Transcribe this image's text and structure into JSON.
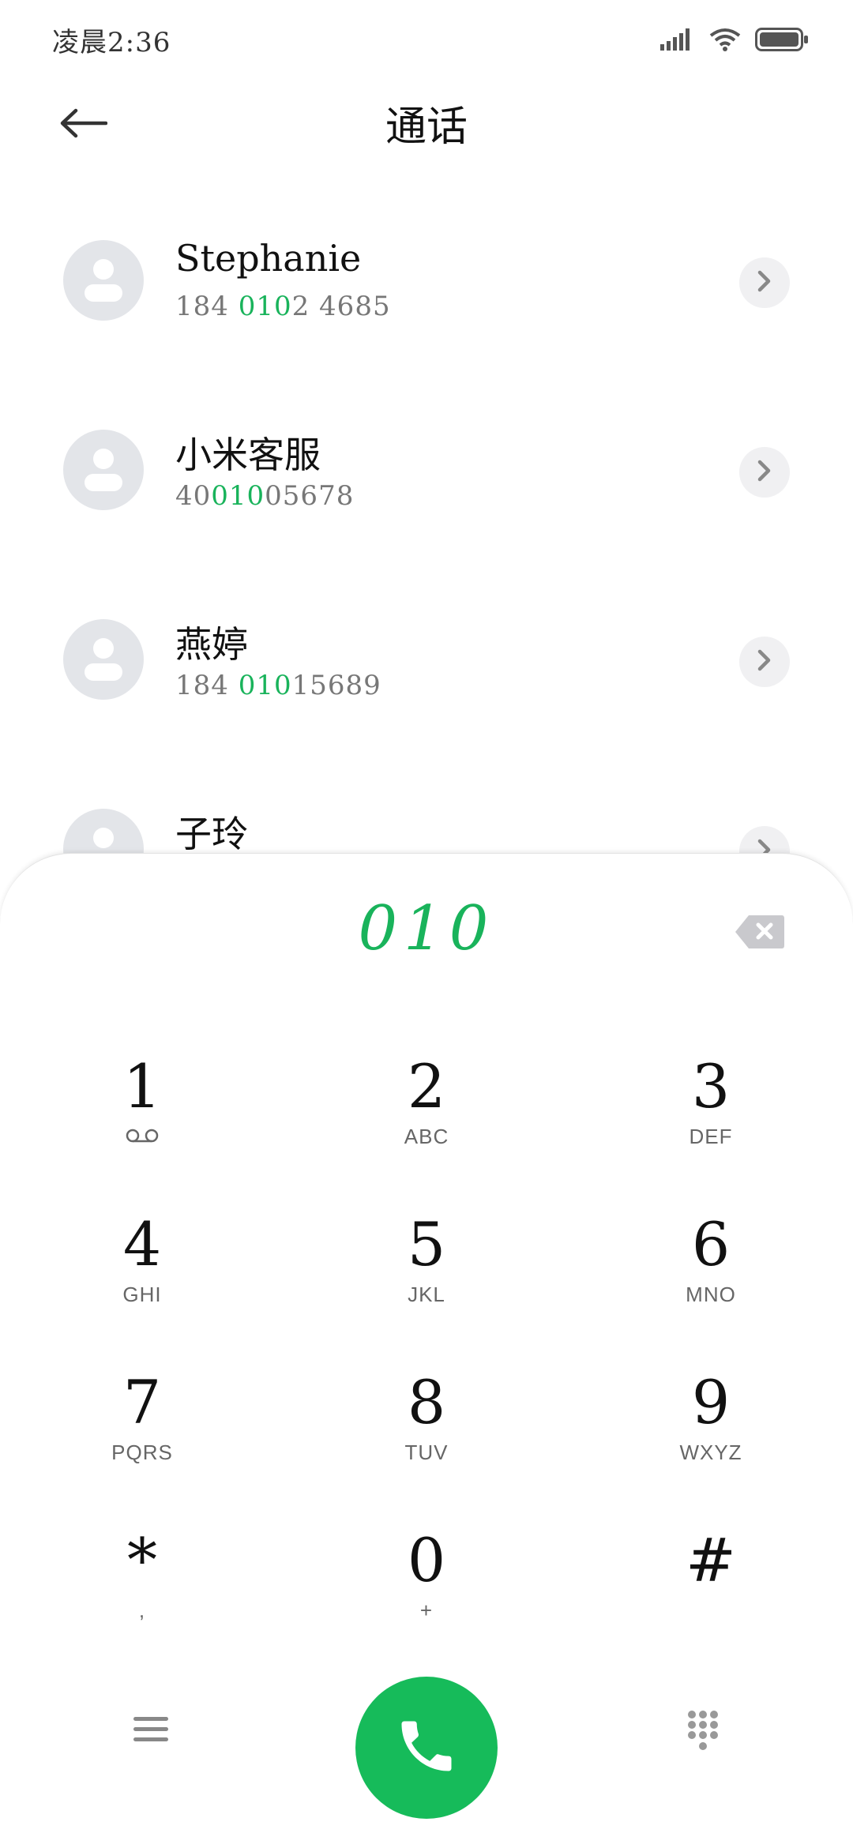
{
  "status_bar": {
    "time": "凌晨2:36",
    "icons": [
      "signal-icon",
      "wifi-icon",
      "battery-icon"
    ]
  },
  "header": {
    "title": "通话",
    "back_icon": "arrow-left-icon"
  },
  "contacts": [
    {
      "name": "Stephanie",
      "number_pre": "184 ",
      "number_match": "010",
      "number_post": "2 4685"
    },
    {
      "name": "小米客服",
      "number_pre": "40",
      "number_match": "010",
      "number_post": "05678"
    },
    {
      "name": "燕婷",
      "number_pre": "184 ",
      "number_match": "010",
      "number_post": "15689"
    },
    {
      "name": "子玲",
      "number_pre": "",
      "number_match": "",
      "number_post": ""
    }
  ],
  "dialpad": {
    "dialed": "010",
    "keys": [
      {
        "digit": "1",
        "letters": ""
      },
      {
        "digit": "2",
        "letters": "ABC"
      },
      {
        "digit": "3",
        "letters": "DEF"
      },
      {
        "digit": "4",
        "letters": "GHI"
      },
      {
        "digit": "5",
        "letters": "JKL"
      },
      {
        "digit": "6",
        "letters": "MNO"
      },
      {
        "digit": "7",
        "letters": "PQRS"
      },
      {
        "digit": "8",
        "letters": "TUV"
      },
      {
        "digit": "9",
        "letters": "WXYZ"
      },
      {
        "digit": "*",
        "letters": ","
      },
      {
        "digit": "0",
        "letters": "+"
      },
      {
        "digit": "#",
        "letters": ""
      }
    ]
  },
  "colors": {
    "accent_green": "#19b35b",
    "call_button": "#16bb5a",
    "avatar_bg": "#e3e5e9"
  }
}
